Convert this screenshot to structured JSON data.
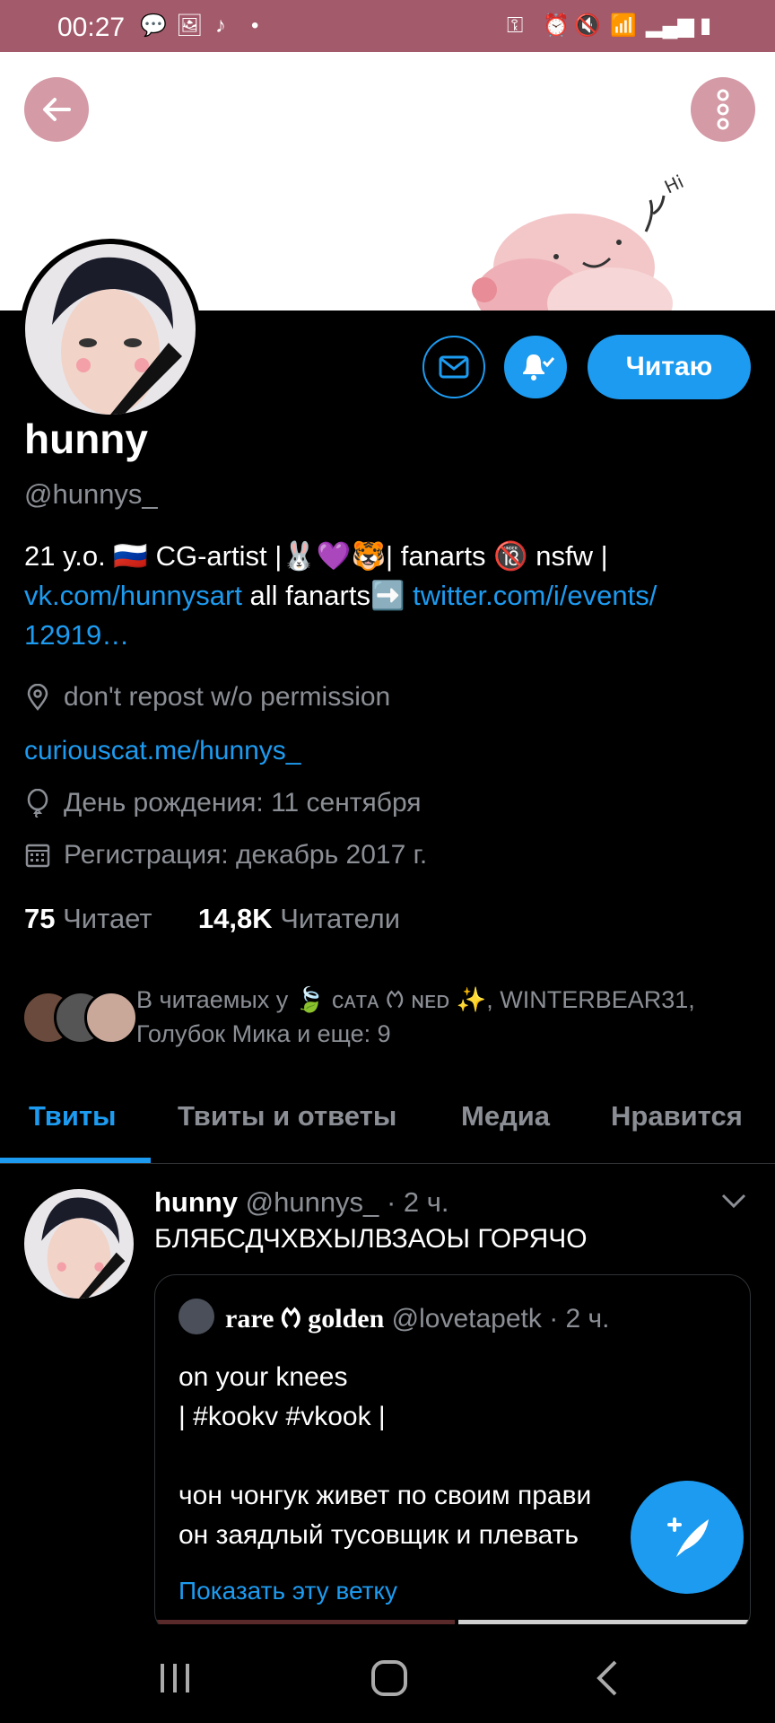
{
  "status_bar": {
    "time": "00:27"
  },
  "profile": {
    "name": "hunny",
    "handle": "@hunnys_",
    "follow_button": "Читаю",
    "bio": {
      "line1_a": "21 y.o. 🇷🇺 CG-artist |🐰💜🐯| fanarts 🔞 nsfw |",
      "line2_link1": "vk.com/hunnysart",
      "line2_text": " all fanarts➡️ ",
      "line2_link2": "twitter.com/i/events/",
      "line3_link": "12919…"
    },
    "location": "don't repost w/o permission",
    "website": "curiouscat.me/hunnys_",
    "birthday": "День рождения: 11 сентября",
    "joined": "Регистрация: декабрь 2017 г.",
    "following_count": "75",
    "following_label": "Читает",
    "followers_count": "14,8K",
    "followers_label": "Читатели",
    "followed_by_line1": "В читаемых у 🍃 ᴄᴀᴛᴀ ᱬ ɴᴇᴅ ✨, WINTERBEAR31,",
    "followed_by_line2": "Голубок Мика и еще: 9"
  },
  "tabs": [
    {
      "label": "Твиты",
      "active": true
    },
    {
      "label": "Твиты и ответы"
    },
    {
      "label": "Медиа"
    },
    {
      "label": "Нравится"
    }
  ],
  "tweet": {
    "author": "hunny",
    "handle": "@hunnys_",
    "time": "· 2 ч.",
    "text": "БЛЯБСДЧХВХЫЛВЗАОЫ ГОРЯЧО",
    "quote": {
      "author": "rare ᱬ golden",
      "handle": "@lovetapetk",
      "time": "· 2 ч.",
      "line1": "on your knees",
      "line2": "| #kookv #vkook |",
      "line3": "чон чонгук живет по своим прави",
      "line4": "он заядлый тусовщик и плевать",
      "show_thread": "Показать эту ветку"
    }
  },
  "colors": {
    "accent": "#1d9bf0",
    "status_bar": "#a35a6a",
    "muted": "#8b8f95"
  }
}
